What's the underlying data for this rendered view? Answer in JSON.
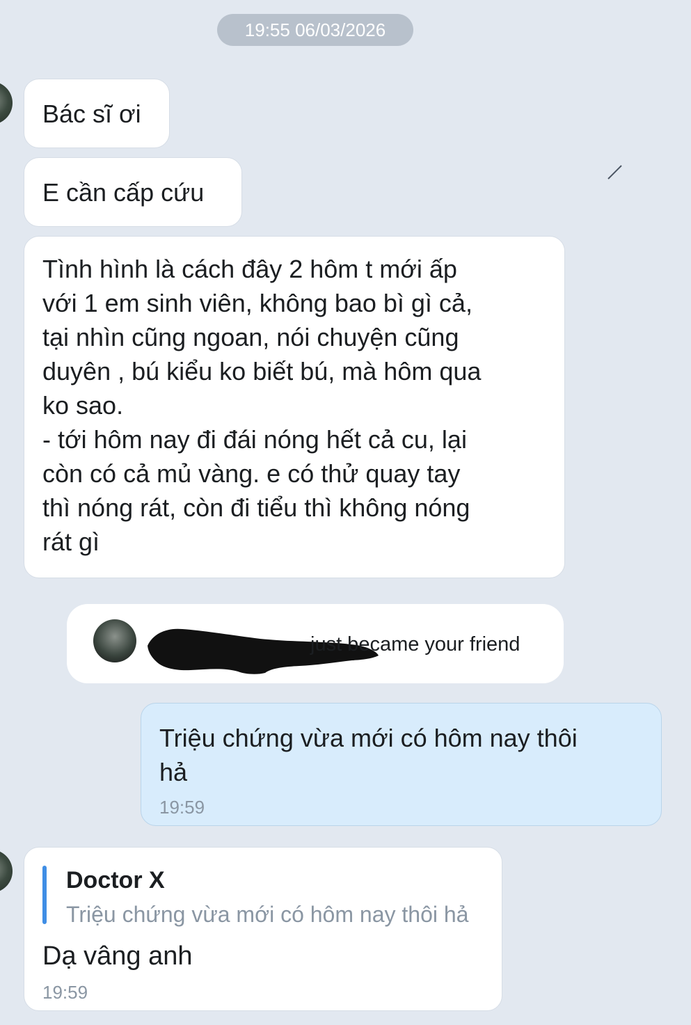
{
  "date_separator": "19:55 06/03/2026",
  "messages": {
    "m1": "Bác sĩ ơi",
    "m2": "E cần cấp cứu",
    "m3": "Tình hình là cách đây 2 hôm t mới ấp\nvới 1 em sinh viên, không bao bì gì cả,\ntại nhìn cũng ngoan, nói chuyện cũng\nduyên , bú kiểu ko biết bú, mà hôm qua\nko sao.\n- tới hôm nay đi đái nóng hết cả cu, lại\ncòn có cả mủ vàng. e có thử quay tay\nthì nóng rát, còn đi tiểu thì không nóng\nrát gì"
  },
  "friend_notice": {
    "text": "just became your friend"
  },
  "sent_message": {
    "text": "Triệu chứng vừa mới có hôm nay thôi\nhả",
    "time": "19:59"
  },
  "reply_message": {
    "quote_author": "Doctor X",
    "quote_text": "Triệu chứng vừa mới có hôm nay thôi hả",
    "text": "Dạ vâng anh",
    "time": "19:59"
  },
  "icons": {
    "avatar": "avatar",
    "edit": "edit-mark-icon",
    "redaction": "redaction-mark"
  },
  "colors": {
    "background": "#e2e8f0",
    "incoming_bubble": "#ffffff",
    "outgoing_bubble": "#d8ecfc",
    "quote_accent": "#3f8ee5",
    "timestamp": "#8a96a3",
    "date_pill": "#b8c1cc"
  }
}
